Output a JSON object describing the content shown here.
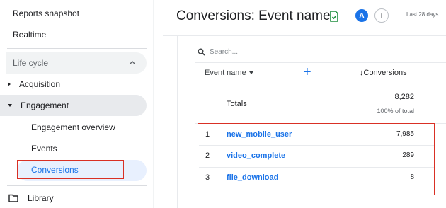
{
  "sidebar": {
    "items": {
      "reports_snapshot": "Reports snapshot",
      "realtime": "Realtime",
      "lifecycle": "Life cycle",
      "acquisition": "Acquisition",
      "engagement": "Engagement",
      "engagement_overview": "Engagement overview",
      "events": "Events",
      "conversions": "Conversions",
      "library": "Library"
    }
  },
  "header": {
    "title": "Conversions: Event name",
    "avatar": "A",
    "add_compare": "+",
    "date_range": "Last 28 days"
  },
  "table": {
    "search_placeholder": "Search...",
    "col_event": "Event name",
    "col_conversions": "↓Conversions",
    "totals_label": "Totals",
    "totals_value": "8,282",
    "totals_pct": "100% of total",
    "rows": [
      {
        "idx": "1",
        "name": "new_mobile_user",
        "value": "7,985"
      },
      {
        "idx": "2",
        "name": "video_complete",
        "value": "289"
      },
      {
        "idx": "3",
        "name": "file_download",
        "value": "8"
      }
    ]
  },
  "colors": {
    "accent": "#1a73e8",
    "highlight_box": "#d93025",
    "selected_bg": "#e8f0fe"
  }
}
